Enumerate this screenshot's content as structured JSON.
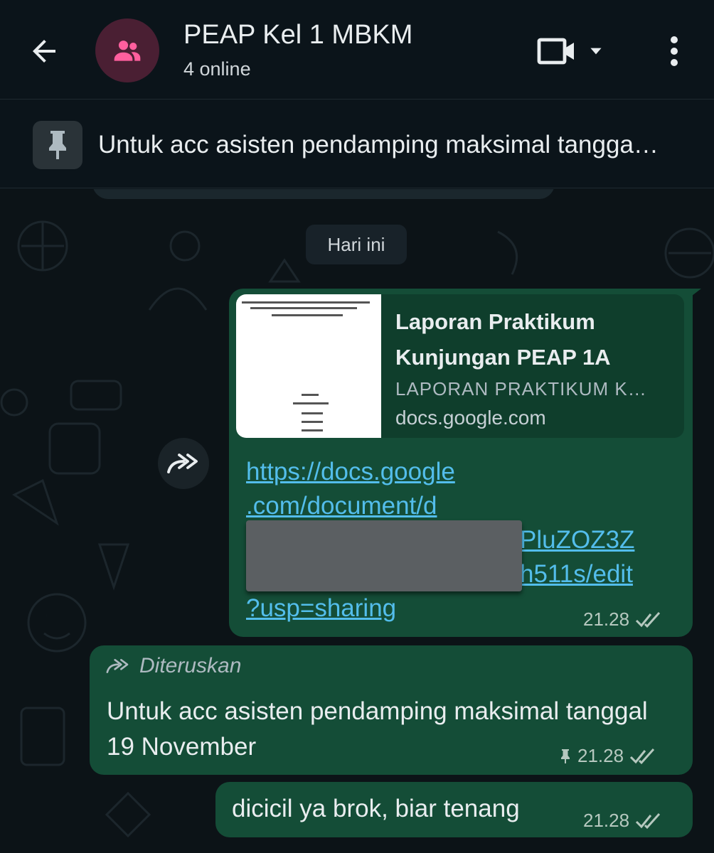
{
  "header": {
    "title": "PEAP Kel 1 MBKM",
    "subtitle": "4 online",
    "icons": {
      "back": "arrow-left-icon",
      "avatar": "group-icon",
      "video": "video-call-icon",
      "dropdown": "chevron-down-icon",
      "menu": "more-vert-icon"
    }
  },
  "pinned": {
    "text": "Untuk acc asisten pendamping maksimal tangga…",
    "icon": "pin-icon"
  },
  "chat": {
    "date_chip": "Hari ini",
    "messages": [
      {
        "type": "link",
        "preview": {
          "title": "Laporan Praktikum Kunjungan PEAP 1A",
          "description": "LAPORAN PRAKTIKUM K…",
          "domain": "docs.google.com"
        },
        "link_lines": [
          "https://docs.google",
          ".com/document/d",
          "PluZOZ3Z",
          "h511s/edit",
          "?usp=sharing"
        ],
        "time": "21.28",
        "status": "read"
      },
      {
        "type": "forwarded",
        "forward_label": "Diteruskan",
        "text": "Untuk acc asisten pendamping maksimal tanggal 19 November",
        "pinned": true,
        "time": "21.28",
        "status": "read"
      },
      {
        "type": "text",
        "text": "dicicil ya brok, biar tenang",
        "time": "21.28",
        "status": "read"
      }
    ]
  },
  "colors": {
    "background": "#0b141a",
    "outgoing_bubble": "#144d37",
    "link": "#53bdeb",
    "read_ticks": "#b6c8bf",
    "avatar_bg": "#4a1f33",
    "avatar_icon": "#ff5f9e"
  }
}
